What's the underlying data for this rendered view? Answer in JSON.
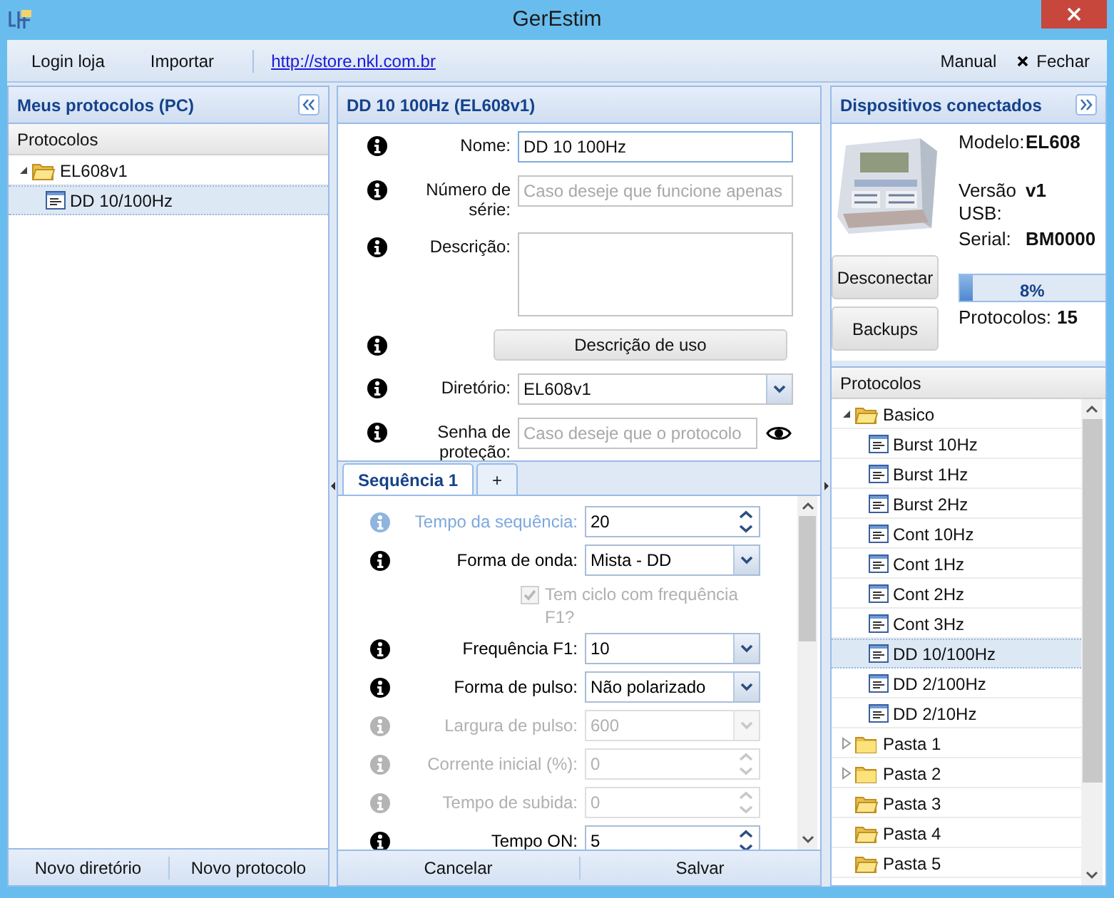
{
  "window": {
    "title": "GerEstim"
  },
  "toolbar": {
    "items": [
      {
        "kind": "button",
        "label": "Login loja"
      },
      {
        "kind": "button",
        "label": "Importar"
      },
      {
        "kind": "link",
        "label": "http://store.nkl.com.br"
      }
    ],
    "right_items": [
      {
        "kind": "button",
        "label": "Manual"
      },
      {
        "kind": "close",
        "label": "Fechar"
      }
    ]
  },
  "left_panel": {
    "title": "Meus protocolos (PC)",
    "tree_header": "Protocolos",
    "tree": [
      {
        "kind": "folder",
        "label": "EL608v1",
        "expandable": true,
        "expanded": true,
        "selected": false,
        "children": [
          {
            "kind": "protocol",
            "label": "DD 10/100Hz",
            "selected": true
          }
        ]
      }
    ],
    "footer_buttons": [
      "Novo diretório",
      "Novo protocolo"
    ]
  },
  "editor": {
    "title": "DD 10 100Hz (EL608v1)",
    "fields": [
      {
        "kind": "text",
        "label": "Nome:",
        "value": "DD 10 100Hz",
        "focused": true
      },
      {
        "kind": "text",
        "label": "Número de série:",
        "placeholder": "Caso deseje que funcione apenas",
        "focused": false
      },
      {
        "kind": "textarea",
        "label": "Descrição:",
        "focused": false
      },
      {
        "kind": "button",
        "label": "Descrição de uso",
        "focused": false
      },
      {
        "kind": "select",
        "label": "Diretório:",
        "value": "EL608v1",
        "focused": false
      },
      {
        "kind": "password",
        "label": "Senha de proteção:",
        "placeholder": "Caso deseje que o protocolo",
        "focused": false
      }
    ],
    "tabs": [
      {
        "label": "Sequência 1",
        "selected": true
      },
      {
        "label": "+",
        "selected": false
      }
    ],
    "sequence_fields": [
      {
        "kind": "spin",
        "label": "Tempo da sequência:",
        "value": "20",
        "disabled": false,
        "highlighted": true
      },
      {
        "kind": "select",
        "label": "Forma de onda:",
        "value": "Mista - DD",
        "disabled": false,
        "highlighted": false
      },
      {
        "kind": "checkbox",
        "label": "Tem ciclo com frequência F1?",
        "checked": true,
        "disabled": true
      },
      {
        "kind": "select",
        "label": "Frequência F1:",
        "value": "10",
        "disabled": false,
        "highlighted": false
      },
      {
        "kind": "select",
        "label": "Forma de pulso:",
        "value": "Não polarizado",
        "disabled": false,
        "highlighted": false
      },
      {
        "kind": "select",
        "label": "Largura de pulso:",
        "value": "600",
        "disabled": true,
        "highlighted": false
      },
      {
        "kind": "spin",
        "label": "Corrente inicial (%):",
        "value": "0",
        "disabled": true,
        "highlighted": false
      },
      {
        "kind": "spin",
        "label": "Tempo de subida:",
        "value": "0",
        "disabled": true,
        "highlighted": false
      },
      {
        "kind": "spin",
        "label": "Tempo ON:",
        "value": "5",
        "disabled": false,
        "highlighted": false
      }
    ],
    "footer_buttons": [
      "Cancelar",
      "Salvar"
    ]
  },
  "right_panel": {
    "title": "Dispositivos conectados",
    "device": {
      "kind": "picture"
    },
    "info": [
      {
        "label": "Modelo:",
        "value": "EL608"
      },
      {
        "label": "Versão USB:",
        "value": "v1"
      },
      {
        "label": "Serial:",
        "value": "BM0000"
      }
    ],
    "buttons": [
      "Desconectar",
      "Backups"
    ],
    "memory": {
      "level": 0.08,
      "reading": "8%"
    },
    "protocol_count": {
      "label": "Protocolos:",
      "value": "15"
    },
    "tree_header": "Protocolos",
    "tree": [
      {
        "kind": "folder",
        "label": "Basico",
        "expandable": true,
        "expanded": true,
        "selected": false,
        "children": [
          {
            "kind": "protocol",
            "label": "Burst 10Hz",
            "selected": false
          },
          {
            "kind": "protocol",
            "label": "Burst 1Hz",
            "selected": false
          },
          {
            "kind": "protocol",
            "label": "Burst 2Hz",
            "selected": false
          },
          {
            "kind": "protocol",
            "label": "Cont 10Hz",
            "selected": false
          },
          {
            "kind": "protocol",
            "label": "Cont 1Hz",
            "selected": false
          },
          {
            "kind": "protocol",
            "label": "Cont 2Hz",
            "selected": false
          },
          {
            "kind": "protocol",
            "label": "Cont 3Hz",
            "selected": false
          },
          {
            "kind": "protocol",
            "label": "DD 10/100Hz",
            "selected": true
          },
          {
            "kind": "protocol",
            "label": "DD 2/100Hz",
            "selected": false
          },
          {
            "kind": "protocol",
            "label": "DD 2/10Hz",
            "selected": false
          }
        ]
      },
      {
        "kind": "folder",
        "label": "Pasta 1",
        "expandable": true,
        "expanded": false,
        "selected": false
      },
      {
        "kind": "folder",
        "label": "Pasta 2",
        "expandable": true,
        "expanded": false,
        "selected": false
      },
      {
        "kind": "folder",
        "label": "Pasta 3",
        "expandable": false,
        "expanded": true,
        "selected": false
      },
      {
        "kind": "folder",
        "label": "Pasta 4",
        "expandable": false,
        "expanded": true,
        "selected": false
      },
      {
        "kind": "folder",
        "label": "Pasta 5",
        "expandable": false,
        "expanded": true,
        "selected": false
      }
    ]
  }
}
